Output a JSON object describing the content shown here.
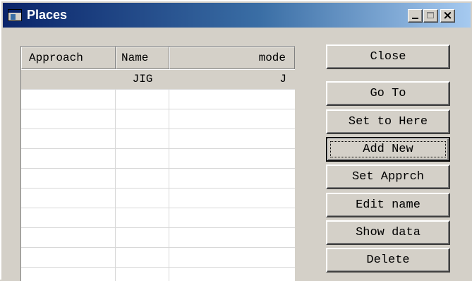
{
  "window": {
    "title": "Places",
    "controls": {
      "minimize": "minimize",
      "maximize": "maximize",
      "close": "close"
    }
  },
  "list": {
    "columns": [
      "Approach",
      "Name",
      "mode"
    ],
    "rows": [
      {
        "approach": "",
        "name": "JIG",
        "mode": "J",
        "selected": true
      }
    ]
  },
  "buttons": {
    "close": "Close",
    "goto": "Go To",
    "set_here": "Set to Here",
    "add_new": "Add New",
    "set_apprch": "Set Apprch",
    "edit_name": "Edit name",
    "show_data": "Show data",
    "delete": "Delete"
  },
  "colors": {
    "titlebar_start": "#0a246a",
    "titlebar_end": "#a6caf0",
    "face": "#d4d0c8"
  },
  "icons": {
    "app": "window-app-icon",
    "close_glyph": "×"
  }
}
